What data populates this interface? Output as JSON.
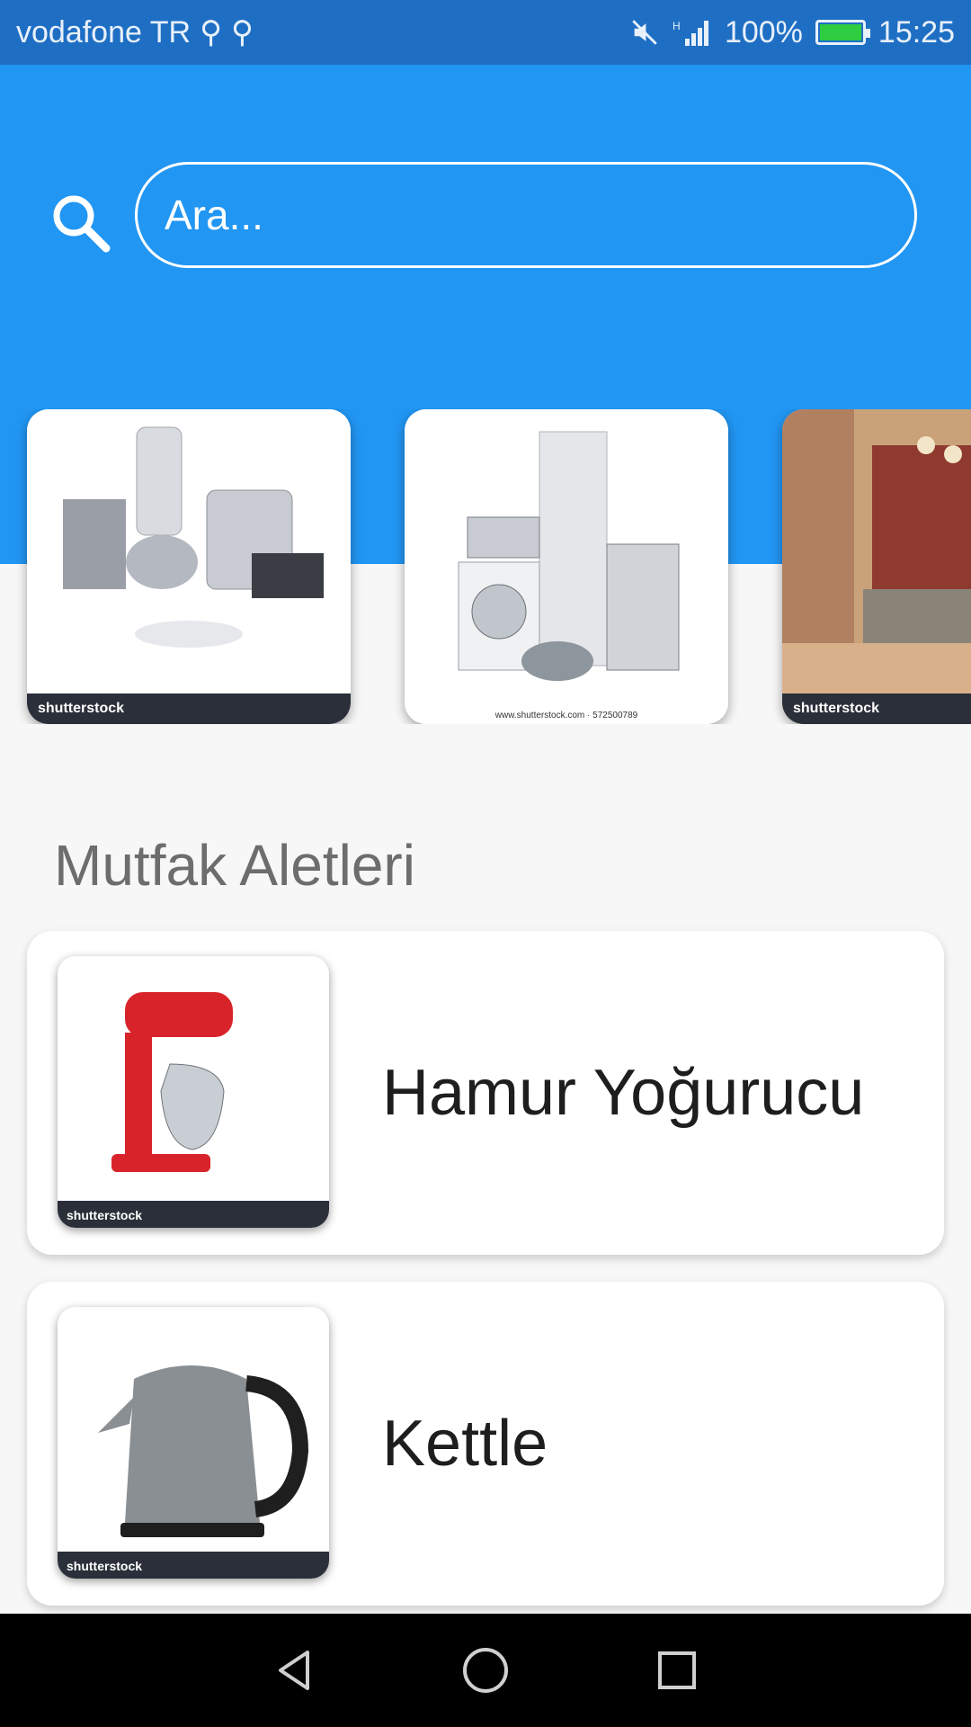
{
  "status_bar": {
    "carrier": "vodafone TR",
    "usb_icons": [
      "usb-icon",
      "usb-icon"
    ],
    "battery_percent": "100%",
    "battery_level": 1.0,
    "time": "15:25"
  },
  "search": {
    "placeholder": "Ara...",
    "icon": "search-icon"
  },
  "carousel": {
    "items": [
      {
        "name": "small-kitchen-appliances",
        "watermark": "shutterstock"
      },
      {
        "name": "home-appliances",
        "watermark": "shutterstock",
        "caption": "www.shutterstock.com · 572500789"
      },
      {
        "name": "living-room-furniture",
        "watermark": "shutterstock"
      }
    ]
  },
  "section": {
    "title": "Mutfak Aletleri"
  },
  "products": [
    {
      "name": "Hamur Yoğurucu",
      "watermark": "shutterstock"
    },
    {
      "name": "Kettle",
      "watermark": "shutterstock"
    }
  ],
  "colors": {
    "header": "#2196f3",
    "status_bar": "#1e6fc4",
    "background": "#f7f7f7"
  },
  "nav": {
    "back": "back-icon",
    "home": "home-icon",
    "recents": "recents-icon"
  }
}
